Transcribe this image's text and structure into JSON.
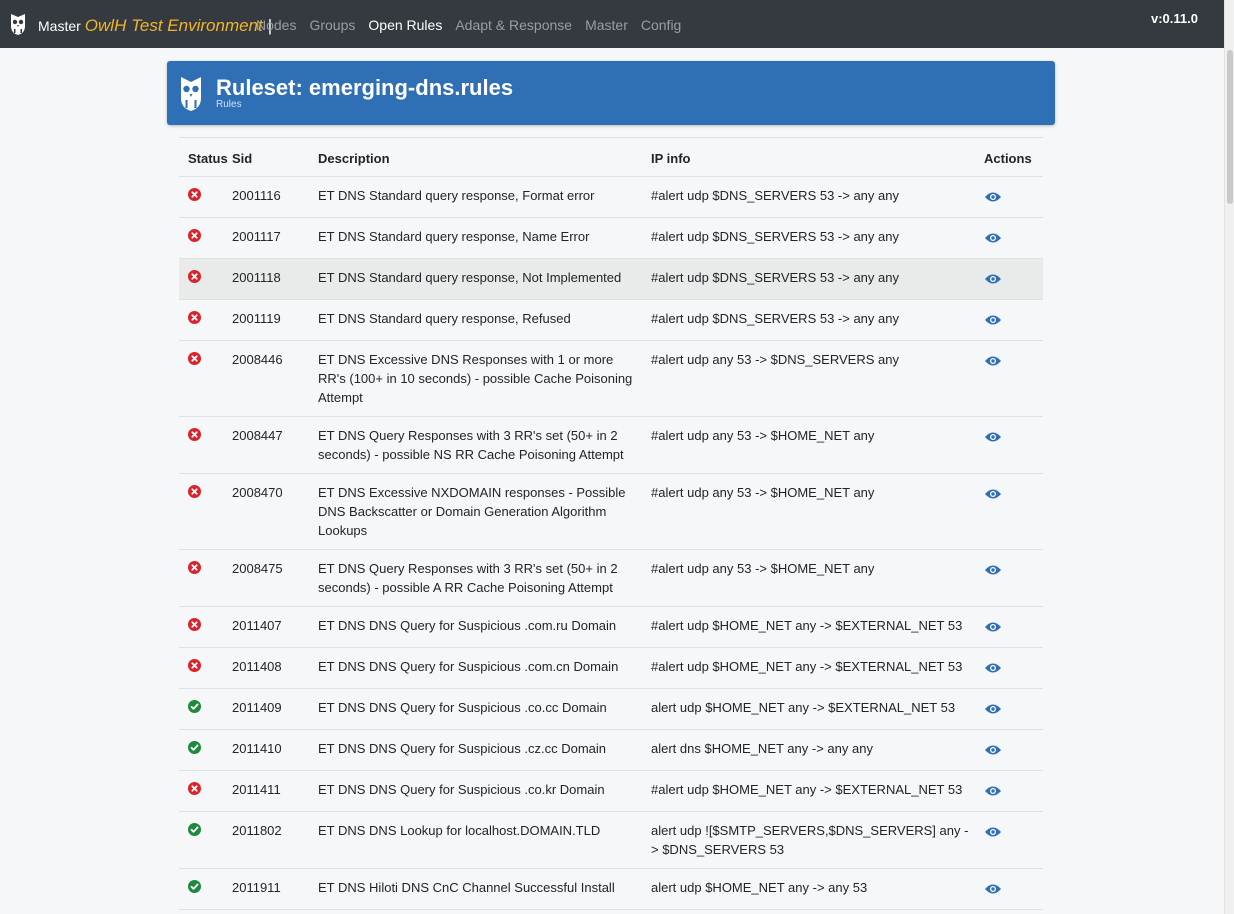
{
  "navbar": {
    "brand_master": "Master",
    "brand_env": "OwlH Test Environment",
    "brand_sep": "|",
    "links": [
      {
        "label": "Nodes",
        "active": false
      },
      {
        "label": "Groups",
        "active": false
      },
      {
        "label": "Open Rules",
        "active": true
      },
      {
        "label": "Adapt & Response",
        "active": false
      },
      {
        "label": "Master",
        "active": false
      },
      {
        "label": "Config",
        "active": false
      }
    ],
    "version": "v:0.11.0"
  },
  "header": {
    "title": "Ruleset: emerging-dns.rules",
    "subtitle": "Rules"
  },
  "table": {
    "columns": {
      "status": "Status",
      "sid": "Sid",
      "description": "Description",
      "ip_info": "IP info",
      "actions": "Actions"
    },
    "rows": [
      {
        "enabled": false,
        "sid": "2001116",
        "description": "ET DNS Standard query response, Format error",
        "ip_info": "#alert udp $DNS_SERVERS 53 -> any any"
      },
      {
        "enabled": false,
        "sid": "2001117",
        "description": "ET DNS Standard query response, Name Error",
        "ip_info": "#alert udp $DNS_SERVERS 53 -> any any"
      },
      {
        "enabled": false,
        "sid": "2001118",
        "description": "ET DNS Standard query response, Not Implemented",
        "ip_info": "#alert udp $DNS_SERVERS 53 -> any any",
        "highlighted": true
      },
      {
        "enabled": false,
        "sid": "2001119",
        "description": "ET DNS Standard query response, Refused",
        "ip_info": "#alert udp $DNS_SERVERS 53 -> any any"
      },
      {
        "enabled": false,
        "sid": "2008446",
        "description": "ET DNS Excessive DNS Responses with 1 or more RR's (100+ in 10 seconds) - possible Cache Poisoning Attempt",
        "ip_info": "#alert udp any 53 -> $DNS_SERVERS any"
      },
      {
        "enabled": false,
        "sid": "2008447",
        "description": "ET DNS Query Responses with 3 RR's set (50+ in 2 seconds) - possible NS RR Cache Poisoning Attempt",
        "ip_info": "#alert udp any 53 -> $HOME_NET any"
      },
      {
        "enabled": false,
        "sid": "2008470",
        "description": "ET DNS Excessive NXDOMAIN responses - Possible DNS Backscatter or Domain Generation Algorithm Lookups",
        "ip_info": "#alert udp any 53 -> $HOME_NET any"
      },
      {
        "enabled": false,
        "sid": "2008475",
        "description": "ET DNS Query Responses with 3 RR's set (50+ in 2 seconds) - possible A RR Cache Poisoning Attempt",
        "ip_info": "#alert udp any 53 -> $HOME_NET any"
      },
      {
        "enabled": false,
        "sid": "2011407",
        "description": "ET DNS DNS Query for Suspicious .com.ru Domain",
        "ip_info": "#alert udp $HOME_NET any -> $EXTERNAL_NET 53"
      },
      {
        "enabled": false,
        "sid": "2011408",
        "description": "ET DNS DNS Query for Suspicious .com.cn Domain",
        "ip_info": "#alert udp $HOME_NET any -> $EXTERNAL_NET 53"
      },
      {
        "enabled": true,
        "sid": "2011409",
        "description": "ET DNS DNS Query for Suspicious .co.cc Domain",
        "ip_info": "alert udp $HOME_NET any -> $EXTERNAL_NET 53"
      },
      {
        "enabled": true,
        "sid": "2011410",
        "description": "ET DNS DNS Query for Suspicious .cz.cc Domain",
        "ip_info": "alert dns $HOME_NET any -> any any"
      },
      {
        "enabled": false,
        "sid": "2011411",
        "description": "ET DNS DNS Query for Suspicious .co.kr Domain",
        "ip_info": "#alert udp $HOME_NET any -> $EXTERNAL_NET 53"
      },
      {
        "enabled": true,
        "sid": "2011802",
        "description": "ET DNS DNS Lookup for localhost.DOMAIN.TLD",
        "ip_info": "alert udp ![$SMTP_SERVERS,$DNS_SERVERS] any -> $DNS_SERVERS 53"
      },
      {
        "enabled": true,
        "sid": "2011911",
        "description": "ET DNS Hiloti DNS CnC Channel Successful Install",
        "ip_info": "alert udp $HOME_NET any -> any 53"
      }
    ]
  },
  "colors": {
    "navbar_bg": "#343a40",
    "brand_accent": "#f0b429",
    "header_bg": "#2f6fb5",
    "status_disabled": "#d9232d",
    "status_enabled": "#1e8a3d",
    "action_icon": "#2f6fb5"
  },
  "icons": {
    "logo": "owl-logo-icon",
    "status_disabled": "x-circle-icon",
    "status_enabled": "check-circle-icon",
    "action": "eye-icon"
  }
}
